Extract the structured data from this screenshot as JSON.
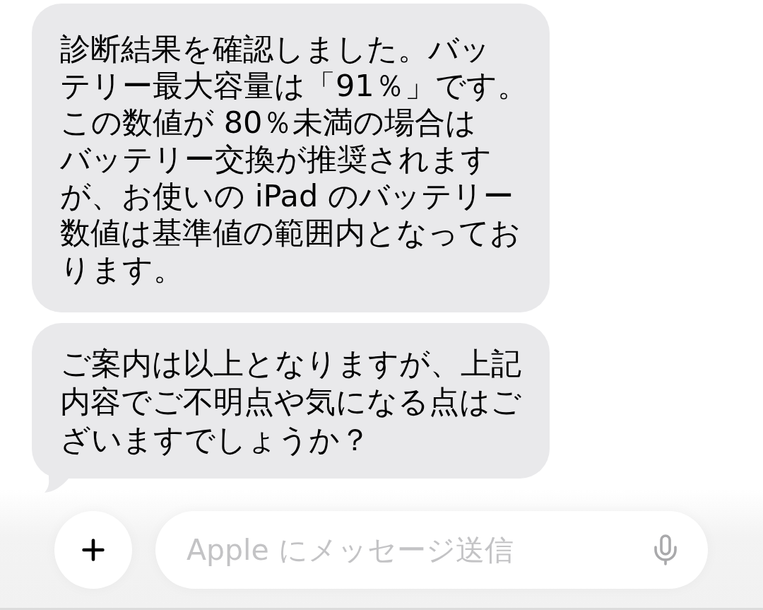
{
  "messages": [
    {
      "tail": false,
      "lines": [
        "診断結果を確認しました。バッ",
        "テリー最大容量は「91％」です。",
        "この数値が 80％未満の場合は",
        "バッテリー交換が推奨されます",
        "が、お使いの iPad のバッテリー",
        "数値は基準値の範囲内となってお",
        "ります。"
      ]
    },
    {
      "tail": true,
      "lines": [
        "ご案内は以上となりますが、上記",
        "内容でご不明点や気になる点はご",
        "ざいますでしょうか？"
      ]
    }
  ],
  "composer": {
    "placeholder": "Apple にメッセージ送信"
  }
}
